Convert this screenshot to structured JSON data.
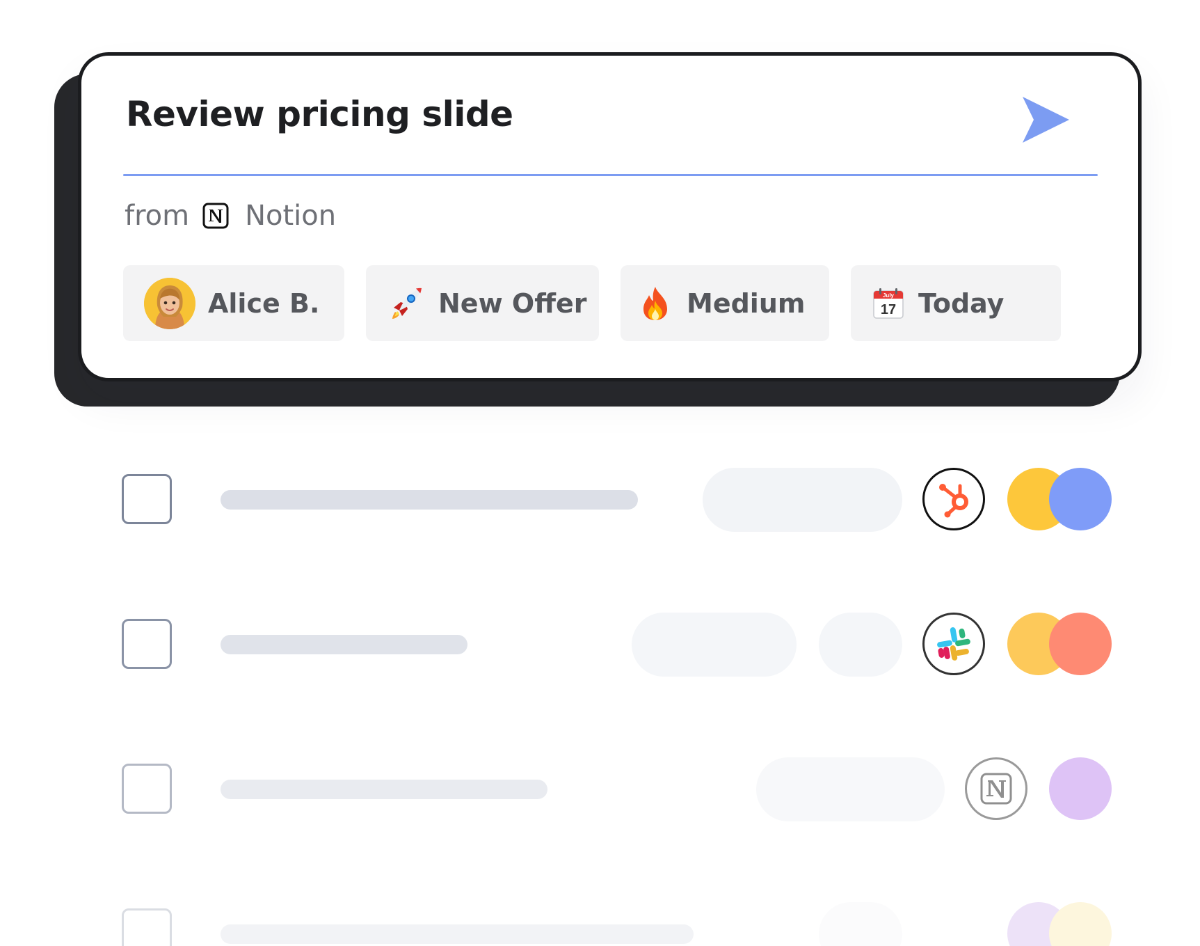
{
  "task": {
    "title": "Review pricing slide",
    "source_prefix": "from",
    "source_app": "Notion",
    "accent_color": "#7c9cf2"
  },
  "chips": {
    "assignee": {
      "label": "Alice B.",
      "icon": "memoji-avatar"
    },
    "project": {
      "label": "New Offer",
      "icon": "rocket-icon"
    },
    "priority": {
      "label": "Medium",
      "icon": "fire-icon"
    },
    "due_date": {
      "label": "Today",
      "icon": "calendar-icon",
      "calendar_month": "July",
      "calendar_day": "17"
    }
  },
  "task_list": [
    {
      "app": "hubspot",
      "assignee_colors": [
        "#fdc73b",
        "#7f9cf8"
      ]
    },
    {
      "app": "slack",
      "assignee_colors": [
        "#fdc95a",
        "#fe8a73"
      ]
    },
    {
      "app": "notion",
      "assignee_colors": [
        "#dec3f6"
      ]
    },
    {
      "app": "",
      "assignee_colors": [
        "#ede2f8",
        "#fdf6dd"
      ]
    }
  ]
}
